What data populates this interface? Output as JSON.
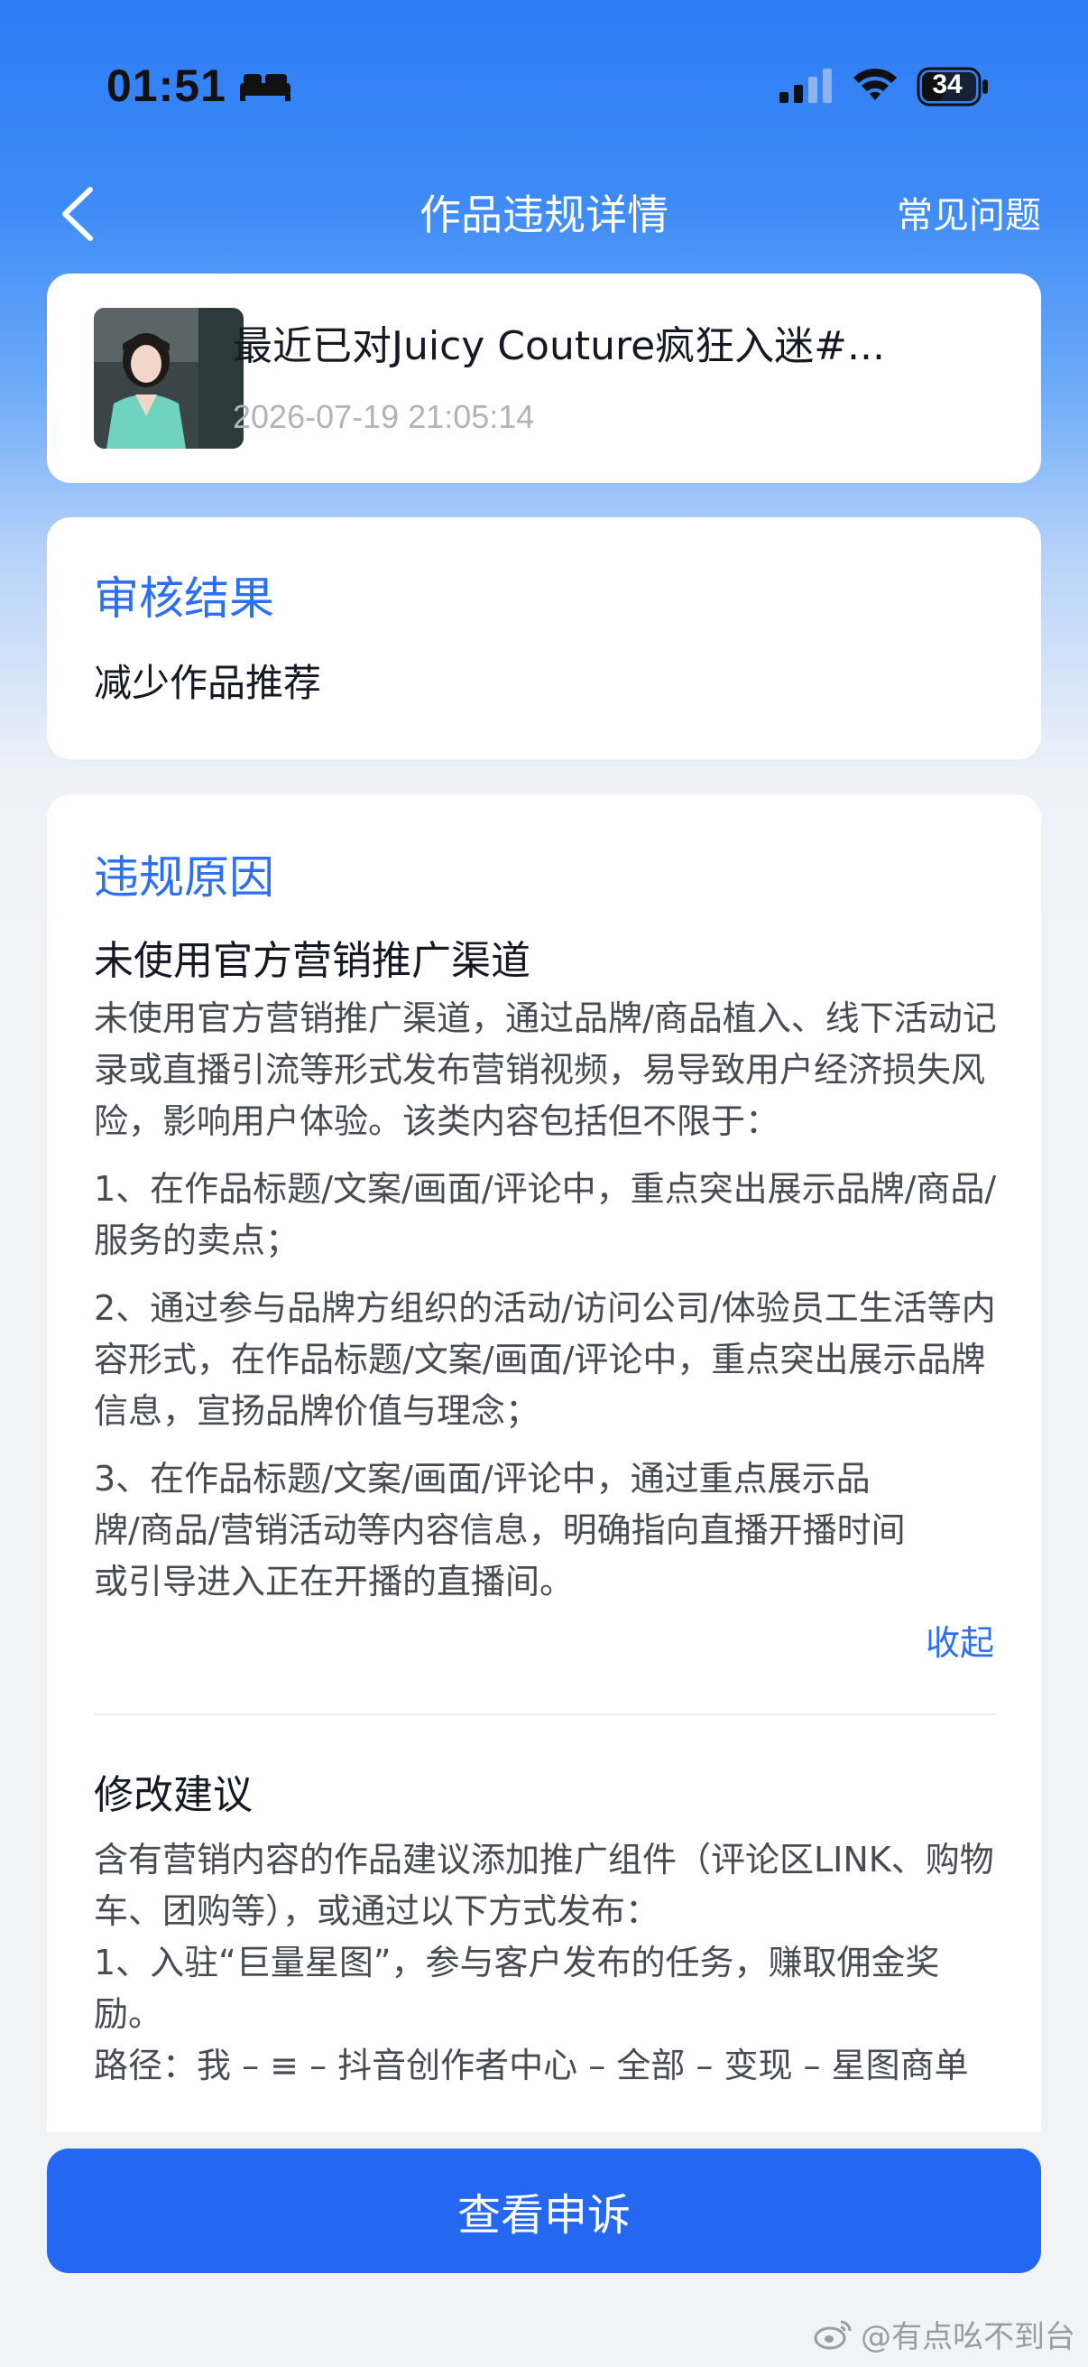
{
  "status_bar": {
    "time": "01:51",
    "battery": "34"
  },
  "nav": {
    "title": "作品违规详情",
    "faq_label": "常见问题"
  },
  "video": {
    "title": "最近已对Juicy Couture疯狂入迷#...",
    "timestamp": "2026-07-19 21:05:14"
  },
  "review": {
    "title": "审核结果",
    "result": "减少作品推荐"
  },
  "violation": {
    "title": "违规原因",
    "heading": "未使用官方营销推广渠道",
    "paragraphs": [
      "未使用官方营销推广渠道，通过品牌/商品植入、线下活动记录或直播引流等形式发布营销视频，易导致用户经济损失风险，影响用户体验。该类内容包括但不限于：",
      "1、在作品标题/文案/画面/评论中，重点突出展示品牌/商品/服务的卖点；",
      "2、通过参与品牌方组织的活动/访问公司/体验员工生活等内容形式，在作品标题/文案/画面/评论中，重点突出展示品牌信息，宣扬品牌价值与理念；",
      "3、在作品标题/文案/画面/评论中，通过重点展示品牌/商品/营销活动等内容信息，明确指向直播开播时间或引导进入正在开播的直播间。"
    ],
    "collapse_label": "收起"
  },
  "suggestion": {
    "heading": "修改建议",
    "lines": [
      "含有营销内容的作品建议添加推广组件（评论区LINK、购物车、团购等），或通过以下方式发布：",
      "1、入驻“巨量星图”，参与客户发布的任务，赚取佣金奖励。",
      "路径：我 – ≡ – 抖音创作者中心 – 全部 – 变现 – 星图商单"
    ]
  },
  "appeal_button": "查看申诉",
  "watermark": "@有点吆不到台",
  "colors": {
    "accent": "#2a6ff5",
    "button": "#2468f2",
    "header_blue": "#2f7cf6"
  }
}
